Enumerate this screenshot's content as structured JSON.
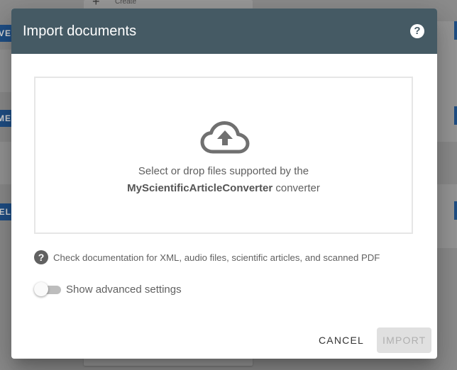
{
  "background": {
    "create_label": "Create",
    "left_buttons": [
      "VE",
      "ME",
      "EL"
    ]
  },
  "dialog": {
    "title": "Import documents",
    "help_label": "?",
    "dropzone": {
      "line1": "Select or drop files supported by the",
      "converter_name": "MyScientificArticleConverter",
      "converter_suffix": " converter"
    },
    "doc_help": {
      "icon_label": "?",
      "text": "Check documentation for XML, audio files, scientific articles, and scanned PDF"
    },
    "advanced_toggle": {
      "label": "Show advanced settings",
      "checked": false
    },
    "actions": {
      "cancel_label": "CANCEL",
      "import_label": "IMPORT",
      "import_disabled": true
    }
  },
  "colors": {
    "header": "#455a64",
    "backdrop": "#8c8c8c",
    "accent_blue": "#1f4f86"
  }
}
